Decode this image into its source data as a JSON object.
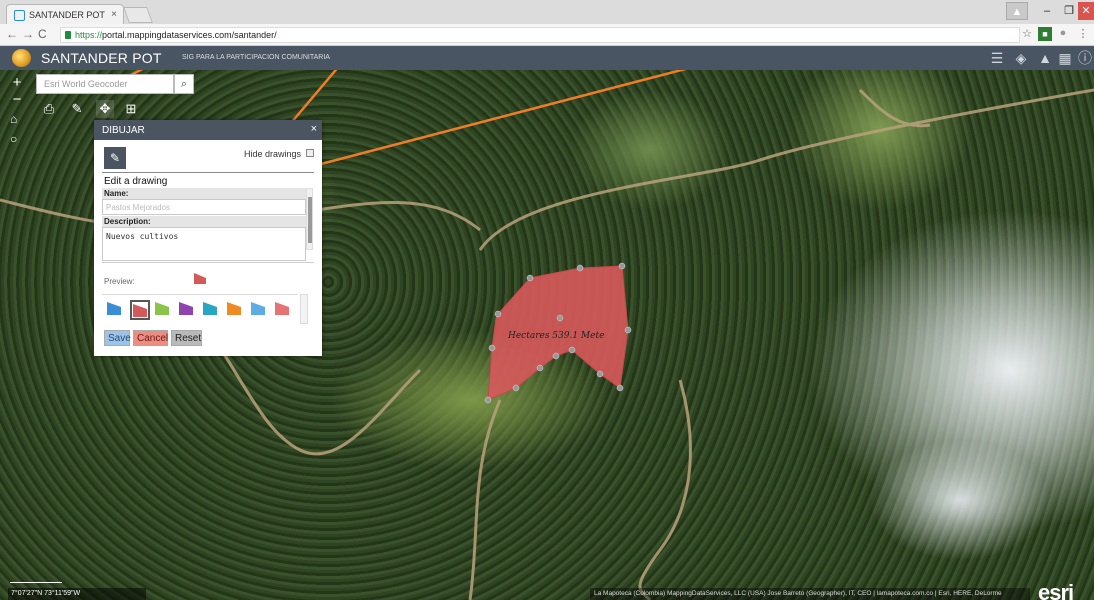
{
  "browser": {
    "tab_title": "SANTANDER POT",
    "tab_close": "×",
    "url_scheme": "https://",
    "url_rest": "portal.mappingdataservices.com/santander/",
    "window_min": "–",
    "window_max": "❐",
    "window_close": "✕"
  },
  "app": {
    "title": "SANTANDER POT",
    "subtitle": "SIG PARA LA PARTICIPACION COMUNITARIA"
  },
  "map": {
    "geocoder_placeholder": "Esri World Geocoder",
    "measure_label": "Hectares 539.1 Mete",
    "coords": "7°07'27\"N 73°11'59\"W",
    "attribution": "La Mapoteca (Colombia) MappingDataServices, LLC (USA) Jose Barreto (Geographer), IT, CEO | lamapoteca.com.co | Esri, HERE, DeLorme",
    "esri_logo": "esri",
    "polygon_color": "#d4595a"
  },
  "panel": {
    "title": "DIBUJAR",
    "close": "×",
    "hide_drawings": "Hide drawings",
    "edit_title": "Edit a drawing",
    "name_label": "Name:",
    "name_placeholder": "Pastos Mejorados",
    "description_label": "Description:",
    "description_value": "Nuevos cultivos",
    "preview_label": "Preview:",
    "swatch_colors": [
      "#3a8fd4",
      "#d4595a",
      "#8bc34a",
      "#8e44ad",
      "#29a6c4",
      "#f08a24",
      "#5dade2",
      "#e57373"
    ],
    "selected_swatch": 1,
    "save": "Save",
    "cancel": "Cancel",
    "reset": "Reset"
  }
}
